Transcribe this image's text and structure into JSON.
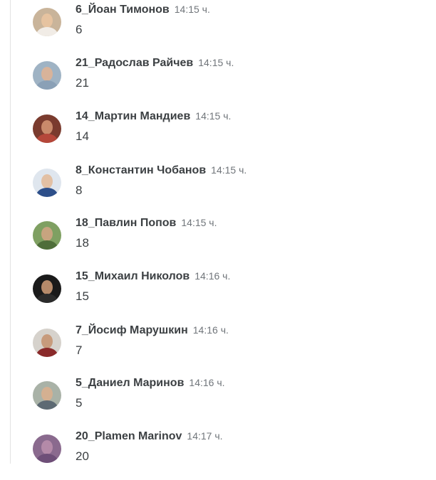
{
  "colors": {
    "sender_text": "#3c4043",
    "time_text": "#70757a",
    "divider": "#e3e3e3"
  },
  "messages": [
    {
      "sender": "6_Йоан Тимонов",
      "time": "14:15 ч.",
      "text": "6",
      "avatar": {
        "bg": "#c9b49a",
        "face": "#e6c3a0",
        "body": "#f1ece6"
      }
    },
    {
      "sender": "21_Радослав Райчев",
      "time": "14:15 ч.",
      "text": "21",
      "avatar": {
        "bg": "#9fb3c4",
        "face": "#d8b39a",
        "body": "#8aa0b6"
      }
    },
    {
      "sender": "14_Мартин Мандиев",
      "time": "14:15 ч.",
      "text": "14",
      "avatar": {
        "bg": "#7a3b2e",
        "face": "#c98a6b",
        "body": "#b5473a"
      }
    },
    {
      "sender": "8_Константин Чобанов",
      "time": "14:15 ч.",
      "text": "8",
      "avatar": {
        "bg": "#dfe6ee",
        "face": "#e2c0a4",
        "body": "#2d4f8a"
      }
    },
    {
      "sender": "18_Павлин Попов",
      "time": "14:15 ч.",
      "text": "18",
      "avatar": {
        "bg": "#7fa062",
        "face": "#c7a47f",
        "body": "#4f6e3a"
      }
    },
    {
      "sender": "15_Михаил Николов",
      "time": "14:16 ч.",
      "text": "15",
      "avatar": {
        "bg": "#1a1a1a",
        "face": "#b68a6a",
        "body": "#2b2b2b"
      }
    },
    {
      "sender": "7_Йосиф Марушкин",
      "time": "14:16 ч.",
      "text": "7",
      "avatar": {
        "bg": "#d6d2cc",
        "face": "#c79b7c",
        "body": "#8a2a2a"
      }
    },
    {
      "sender": "5_Даниел Маринов",
      "time": "14:16 ч.",
      "text": "5",
      "avatar": {
        "bg": "#a9b2a7",
        "face": "#d4b091",
        "body": "#5d6a73"
      }
    },
    {
      "sender": "20_Plamen Marinov",
      "time": "14:17 ч.",
      "text": "20",
      "avatar": {
        "bg": "#8a6a8e",
        "face": "#b48aa8",
        "body": "#6e4f78"
      }
    }
  ]
}
